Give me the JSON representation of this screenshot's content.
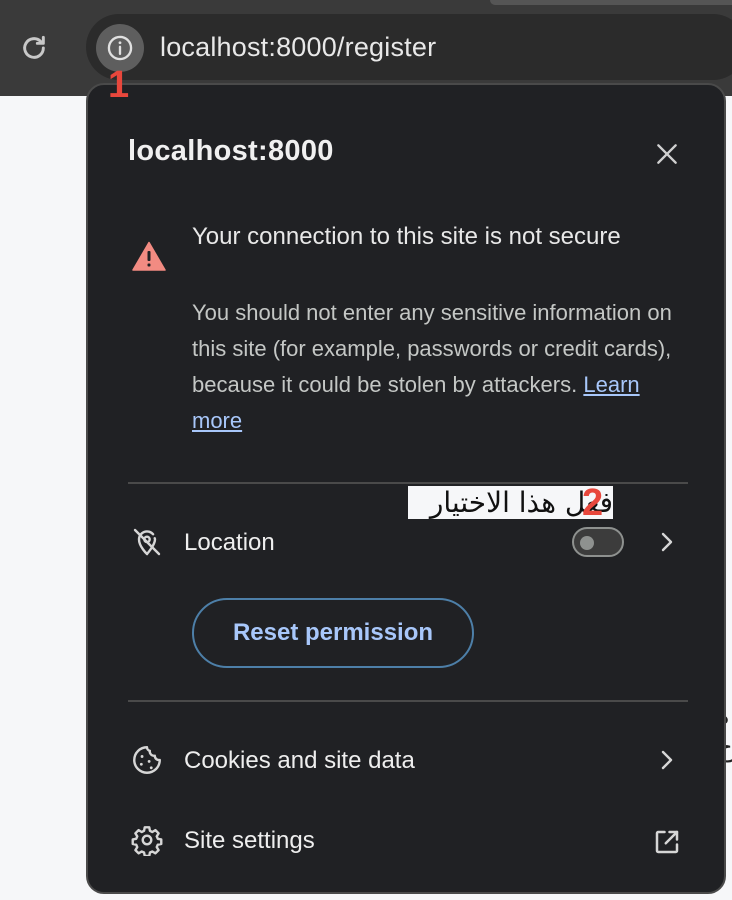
{
  "browser": {
    "url": "localhost:8000/register",
    "icons": {
      "reload": "reload-icon",
      "site_info": "info-icon"
    }
  },
  "annotations": {
    "marker_1": "1",
    "marker_2": "2",
    "note": "فعل هذا الاختيار",
    "color": "#e8473c"
  },
  "popup": {
    "title": "localhost:8000",
    "close_icon": "close-icon",
    "security": {
      "icon": "warning-triangle-icon",
      "icon_color": "#f28b82",
      "title": "Your connection to this site is not secure",
      "body": "You should not enter any sensitive information on this site (for example, passwords or credit cards), because it could be stolen by attackers.",
      "learn_more": "Learn more"
    },
    "location": {
      "icon": "location-off-icon",
      "label": "Location",
      "toggle_on": false,
      "reset_label": "Reset permission"
    },
    "cookies": {
      "icon": "cookie-icon",
      "label": "Cookies and site data"
    },
    "site_settings": {
      "icon": "gear-icon",
      "label": "Site settings",
      "action_icon": "open-in-new-icon"
    }
  },
  "page_peek": {
    "line1": "ه",
    "line2": "ح"
  }
}
